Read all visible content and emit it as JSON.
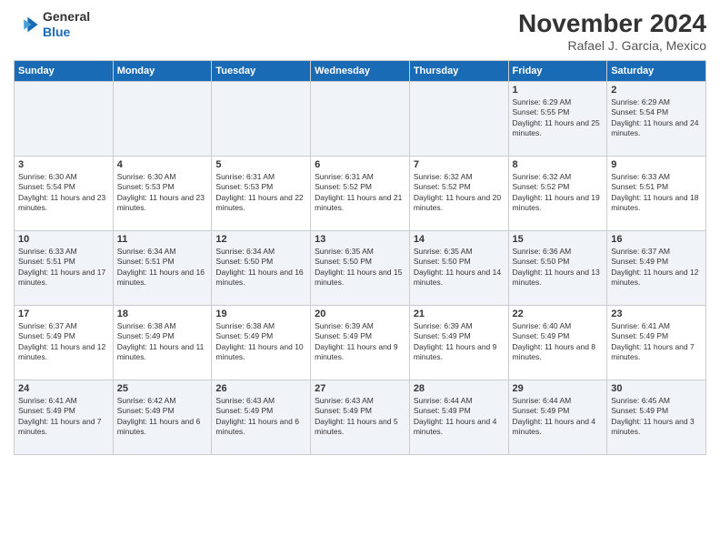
{
  "header": {
    "logo_line1": "General",
    "logo_line2": "Blue",
    "month": "November 2024",
    "location": "Rafael J. Garcia, Mexico"
  },
  "weekdays": [
    "Sunday",
    "Monday",
    "Tuesday",
    "Wednesday",
    "Thursday",
    "Friday",
    "Saturday"
  ],
  "weeks": [
    [
      {
        "day": "",
        "info": ""
      },
      {
        "day": "",
        "info": ""
      },
      {
        "day": "",
        "info": ""
      },
      {
        "day": "",
        "info": ""
      },
      {
        "day": "",
        "info": ""
      },
      {
        "day": "1",
        "info": "Sunrise: 6:29 AM\nSunset: 5:55 PM\nDaylight: 11 hours and 25 minutes."
      },
      {
        "day": "2",
        "info": "Sunrise: 6:29 AM\nSunset: 5:54 PM\nDaylight: 11 hours and 24 minutes."
      }
    ],
    [
      {
        "day": "3",
        "info": "Sunrise: 6:30 AM\nSunset: 5:54 PM\nDaylight: 11 hours and 23 minutes."
      },
      {
        "day": "4",
        "info": "Sunrise: 6:30 AM\nSunset: 5:53 PM\nDaylight: 11 hours and 23 minutes."
      },
      {
        "day": "5",
        "info": "Sunrise: 6:31 AM\nSunset: 5:53 PM\nDaylight: 11 hours and 22 minutes."
      },
      {
        "day": "6",
        "info": "Sunrise: 6:31 AM\nSunset: 5:52 PM\nDaylight: 11 hours and 21 minutes."
      },
      {
        "day": "7",
        "info": "Sunrise: 6:32 AM\nSunset: 5:52 PM\nDaylight: 11 hours and 20 minutes."
      },
      {
        "day": "8",
        "info": "Sunrise: 6:32 AM\nSunset: 5:52 PM\nDaylight: 11 hours and 19 minutes."
      },
      {
        "day": "9",
        "info": "Sunrise: 6:33 AM\nSunset: 5:51 PM\nDaylight: 11 hours and 18 minutes."
      }
    ],
    [
      {
        "day": "10",
        "info": "Sunrise: 6:33 AM\nSunset: 5:51 PM\nDaylight: 11 hours and 17 minutes."
      },
      {
        "day": "11",
        "info": "Sunrise: 6:34 AM\nSunset: 5:51 PM\nDaylight: 11 hours and 16 minutes."
      },
      {
        "day": "12",
        "info": "Sunrise: 6:34 AM\nSunset: 5:50 PM\nDaylight: 11 hours and 16 minutes."
      },
      {
        "day": "13",
        "info": "Sunrise: 6:35 AM\nSunset: 5:50 PM\nDaylight: 11 hours and 15 minutes."
      },
      {
        "day": "14",
        "info": "Sunrise: 6:35 AM\nSunset: 5:50 PM\nDaylight: 11 hours and 14 minutes."
      },
      {
        "day": "15",
        "info": "Sunrise: 6:36 AM\nSunset: 5:50 PM\nDaylight: 11 hours and 13 minutes."
      },
      {
        "day": "16",
        "info": "Sunrise: 6:37 AM\nSunset: 5:49 PM\nDaylight: 11 hours and 12 minutes."
      }
    ],
    [
      {
        "day": "17",
        "info": "Sunrise: 6:37 AM\nSunset: 5:49 PM\nDaylight: 11 hours and 12 minutes."
      },
      {
        "day": "18",
        "info": "Sunrise: 6:38 AM\nSunset: 5:49 PM\nDaylight: 11 hours and 11 minutes."
      },
      {
        "day": "19",
        "info": "Sunrise: 6:38 AM\nSunset: 5:49 PM\nDaylight: 11 hours and 10 minutes."
      },
      {
        "day": "20",
        "info": "Sunrise: 6:39 AM\nSunset: 5:49 PM\nDaylight: 11 hours and 9 minutes."
      },
      {
        "day": "21",
        "info": "Sunrise: 6:39 AM\nSunset: 5:49 PM\nDaylight: 11 hours and 9 minutes."
      },
      {
        "day": "22",
        "info": "Sunrise: 6:40 AM\nSunset: 5:49 PM\nDaylight: 11 hours and 8 minutes."
      },
      {
        "day": "23",
        "info": "Sunrise: 6:41 AM\nSunset: 5:49 PM\nDaylight: 11 hours and 7 minutes."
      }
    ],
    [
      {
        "day": "24",
        "info": "Sunrise: 6:41 AM\nSunset: 5:49 PM\nDaylight: 11 hours and 7 minutes."
      },
      {
        "day": "25",
        "info": "Sunrise: 6:42 AM\nSunset: 5:49 PM\nDaylight: 11 hours and 6 minutes."
      },
      {
        "day": "26",
        "info": "Sunrise: 6:43 AM\nSunset: 5:49 PM\nDaylight: 11 hours and 6 minutes."
      },
      {
        "day": "27",
        "info": "Sunrise: 6:43 AM\nSunset: 5:49 PM\nDaylight: 11 hours and 5 minutes."
      },
      {
        "day": "28",
        "info": "Sunrise: 6:44 AM\nSunset: 5:49 PM\nDaylight: 11 hours and 4 minutes."
      },
      {
        "day": "29",
        "info": "Sunrise: 6:44 AM\nSunset: 5:49 PM\nDaylight: 11 hours and 4 minutes."
      },
      {
        "day": "30",
        "info": "Sunrise: 6:45 AM\nSunset: 5:49 PM\nDaylight: 11 hours and 3 minutes."
      }
    ]
  ]
}
